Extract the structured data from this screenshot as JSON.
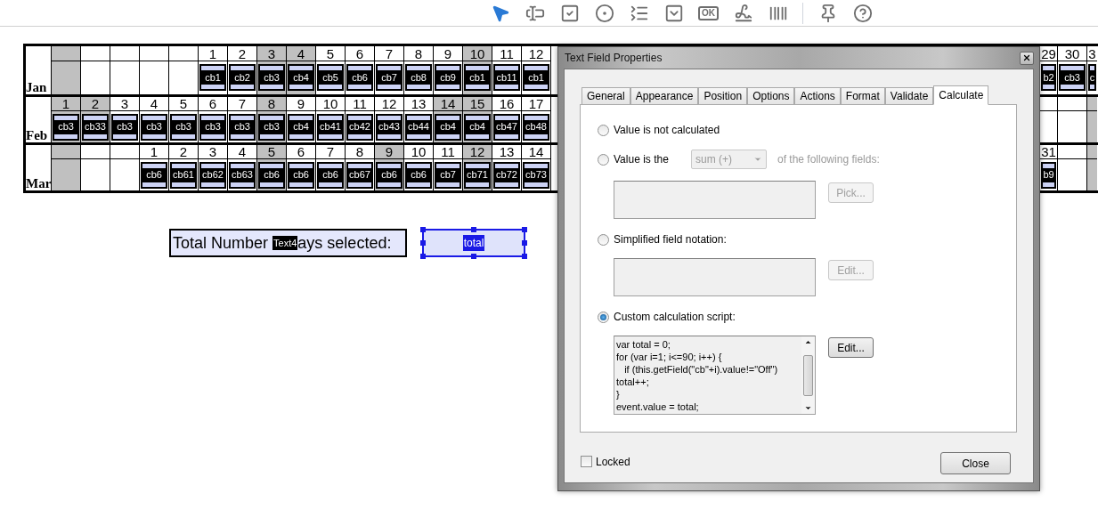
{
  "toolbar": {
    "tools": [
      {
        "kind": "select",
        "selected": true
      },
      {
        "kind": "text-field",
        "selected": false
      },
      {
        "kind": "checkbox",
        "selected": false
      },
      {
        "kind": "radio",
        "selected": false
      },
      {
        "kind": "list-box",
        "selected": false
      },
      {
        "kind": "dropdown",
        "selected": false
      },
      {
        "kind": "button",
        "text": "OK",
        "selected": false
      },
      {
        "kind": "signature",
        "selected": false
      },
      {
        "kind": "barcode",
        "selected": false
      },
      {
        "kind": "separator"
      },
      {
        "kind": "pin",
        "selected": false
      },
      {
        "kind": "help",
        "selected": false
      }
    ]
  },
  "calendar": {
    "months": [
      {
        "name": "Jan",
        "left": [
          {
            "weekend": true
          },
          {
            "weekend": false
          },
          {
            "weekend": false
          },
          {
            "weekend": false
          },
          {
            "weekend": false
          },
          {
            "day": "1",
            "field": "cb1",
            "weekend": false
          },
          {
            "day": "2",
            "field": "cb2",
            "weekend": false
          },
          {
            "day": "3",
            "field": "cb3",
            "weekend": true
          },
          {
            "day": "4",
            "field": "cb4",
            "weekend": true
          },
          {
            "day": "5",
            "field": "cb5",
            "weekend": false
          },
          {
            "day": "6",
            "field": "cb6",
            "weekend": false
          },
          {
            "day": "7",
            "field": "cb7",
            "weekend": false
          },
          {
            "day": "8",
            "field": "cb8",
            "weekend": false
          },
          {
            "day": "9",
            "field": "cb9",
            "weekend": false
          },
          {
            "day": "10",
            "field": "cb1",
            "weekend": true
          },
          {
            "day": "11",
            "field": "cb11",
            "weekend": false
          },
          {
            "day": "12",
            "field": "cb1",
            "weekend": false
          }
        ],
        "right": [
          {
            "day": "29",
            "field": "b2",
            "weekend": false
          },
          {
            "day": "30",
            "field": "cb3",
            "weekend": false
          },
          {
            "day": "3",
            "field": "c",
            "weekend": false
          }
        ]
      },
      {
        "name": "Feb",
        "left": [
          {
            "day": "1",
            "field": "cb3",
            "weekend": true
          },
          {
            "day": "2",
            "field": "cb33",
            "weekend": true
          },
          {
            "day": "3",
            "field": "cb3",
            "weekend": false
          },
          {
            "day": "4",
            "field": "cb3",
            "weekend": false
          },
          {
            "day": "5",
            "field": "cb3",
            "weekend": false
          },
          {
            "day": "6",
            "field": "cb3",
            "weekend": false
          },
          {
            "day": "7",
            "field": "cb3",
            "weekend": false
          },
          {
            "day": "8",
            "field": "cb3",
            "weekend": true
          },
          {
            "day": "9",
            "field": "cb4",
            "weekend": false
          },
          {
            "day": "10",
            "field": "cb41",
            "weekend": false
          },
          {
            "day": "11",
            "field": "cb42",
            "weekend": false
          },
          {
            "day": "12",
            "field": "cb43",
            "weekend": false
          },
          {
            "day": "13",
            "field": "cb44",
            "weekend": false
          },
          {
            "day": "14",
            "field": "cb4",
            "weekend": true
          },
          {
            "day": "15",
            "field": "cb4",
            "weekend": true
          },
          {
            "day": "16",
            "field": "cb47",
            "weekend": false
          },
          {
            "day": "17",
            "field": "cb48",
            "weekend": false
          }
        ],
        "right": [
          {
            "weekend": false
          },
          {
            "weekend": false
          },
          {
            "weekend": true
          }
        ]
      },
      {
        "name": "Mar",
        "left": [
          {
            "weekend": true
          },
          {
            "weekend": false
          },
          {
            "weekend": false
          },
          {
            "day": "1",
            "field": "cb6",
            "weekend": false
          },
          {
            "day": "2",
            "field": "cb61",
            "weekend": false
          },
          {
            "day": "3",
            "field": "cb62",
            "weekend": false
          },
          {
            "day": "4",
            "field": "cb63",
            "weekend": false
          },
          {
            "day": "5",
            "field": "cb6",
            "weekend": true
          },
          {
            "day": "6",
            "field": "cb6",
            "weekend": false
          },
          {
            "day": "7",
            "field": "cb6",
            "weekend": false
          },
          {
            "day": "8",
            "field": "cb67",
            "weekend": false
          },
          {
            "day": "9",
            "field": "cb6",
            "weekend": true
          },
          {
            "day": "10",
            "field": "cb6",
            "weekend": false
          },
          {
            "day": "11",
            "field": "cb7",
            "weekend": false
          },
          {
            "day": "12",
            "field": "cb71",
            "weekend": true
          },
          {
            "day": "13",
            "field": "cb72",
            "weekend": false
          },
          {
            "day": "14",
            "field": "cb73",
            "weekend": false
          }
        ],
        "right": [
          {
            "day": "31",
            "field": "b9",
            "weekend": false
          },
          {
            "weekend": false
          },
          {
            "weekend": true
          }
        ]
      }
    ]
  },
  "form": {
    "label_start": "Total Number",
    "badge": "Text4",
    "label_end": "ays selected:",
    "total_field": {
      "name": "total",
      "selected": true
    }
  },
  "dialog": {
    "title": "Text Field Properties",
    "tabs": [
      {
        "label": "General",
        "selected": false
      },
      {
        "label": "Appearance",
        "selected": false
      },
      {
        "label": "Position",
        "selected": false
      },
      {
        "label": "Options",
        "selected": false
      },
      {
        "label": "Actions",
        "selected": false
      },
      {
        "label": "Format",
        "selected": false
      },
      {
        "label": "Validate",
        "selected": false
      },
      {
        "label": "Calculate",
        "selected": true
      }
    ],
    "options": [
      {
        "kind": "plain",
        "label": "Value is not calculated",
        "selected": false
      },
      {
        "kind": "operation",
        "label": "Value is the",
        "selected": false,
        "dropdown": {
          "value": "sum (+)",
          "disabled": true
        },
        "suffix": "of the following fields:",
        "button": {
          "label": "Pick...",
          "disabled": true
        }
      },
      {
        "kind": "notation",
        "label": "Simplified field notation:",
        "selected": false,
        "button": {
          "label": "Edit...",
          "disabled": true
        }
      },
      {
        "kind": "script",
        "label": "Custom calculation script:",
        "selected": true,
        "script": [
          "var total = 0;",
          "for (var i=1; i<=90; i++) {",
          "   if (this.getField(\"cb\"+i).value!=\"Off\")",
          "total++;",
          "}",
          "event.value = total;"
        ],
        "button": {
          "label": "Edit...",
          "disabled": false
        }
      }
    ],
    "locked": {
      "label": "Locked",
      "checked": false
    },
    "close_button": "Close"
  }
}
